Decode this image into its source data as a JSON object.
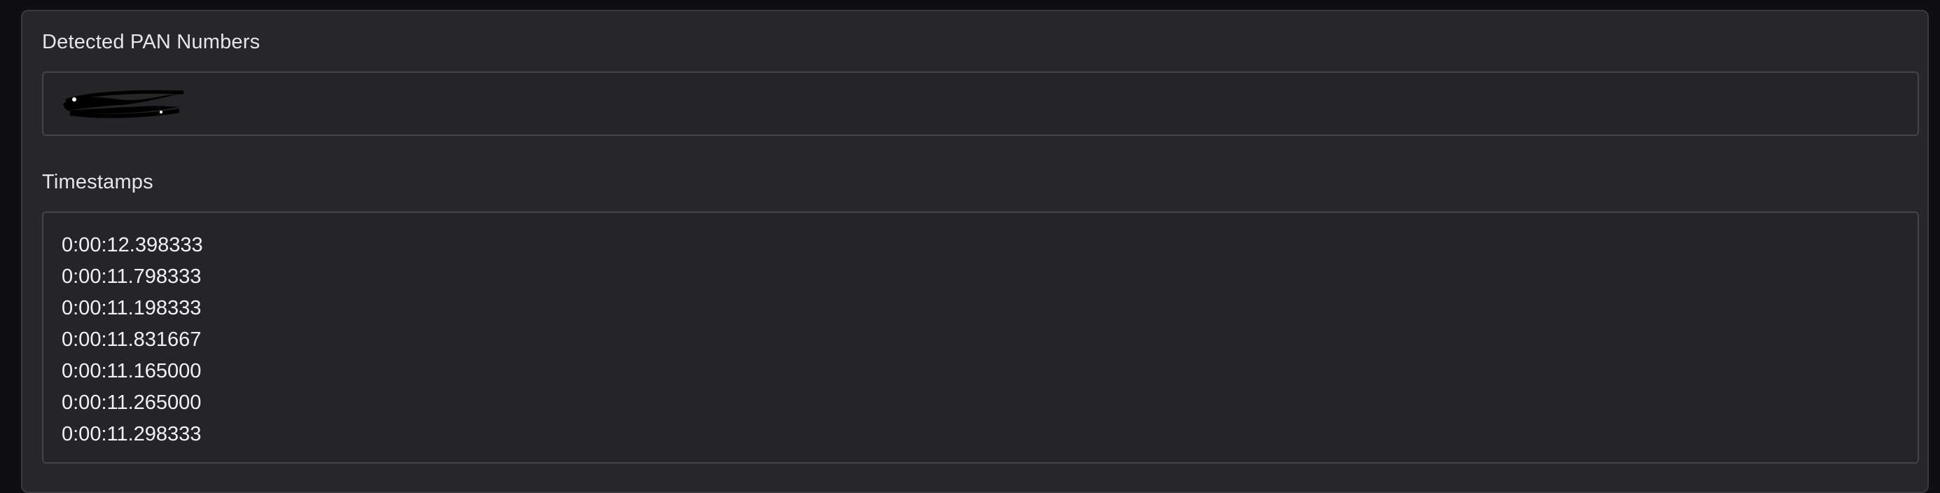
{
  "panel": {
    "pan_section": {
      "label": "Detected PAN Numbers",
      "value_redacted": true
    },
    "timestamps_section": {
      "label": "Timestamps",
      "values": [
        "0:00:12.398333",
        "0:00:11.798333",
        "0:00:11.198333",
        "0:00:11.831667",
        "0:00:11.165000",
        "0:00:11.265000",
        "0:00:11.298333"
      ]
    }
  },
  "colors": {
    "page_bg": "#0f0f11",
    "panel_bg": "#27272a",
    "box_border": "#44444a",
    "text": "#e6e6ea",
    "redaction": "#000000"
  }
}
